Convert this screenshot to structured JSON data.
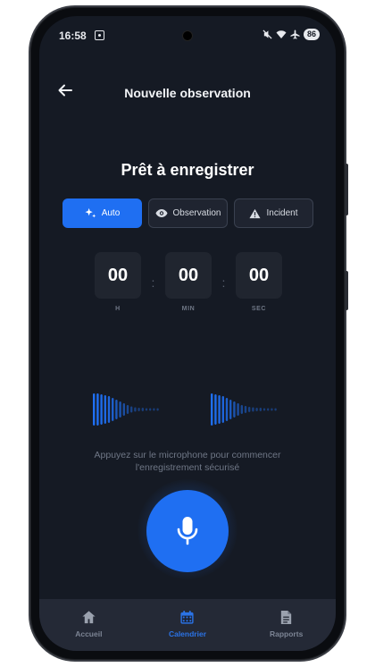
{
  "status": {
    "time": "16:58",
    "battery": "86"
  },
  "header": {
    "title": "Nouvelle observation",
    "back_icon": "arrow-left-icon"
  },
  "main": {
    "title": "Prêt à enregistrer",
    "modes": [
      {
        "label": "Auto",
        "icon": "sparkles-icon",
        "active": true
      },
      {
        "label": "Observation",
        "icon": "eye-icon",
        "active": false
      },
      {
        "label": "Incident",
        "icon": "warning-triangle-icon",
        "active": false
      }
    ],
    "timer": {
      "hours": "00",
      "minutes": "00",
      "seconds": "00",
      "hours_label": "H",
      "minutes_label": "MIN",
      "seconds_label": "SEC"
    },
    "hint": "Appuyez sur le microphone pour commencer l'enregistrement sécurisé"
  },
  "nav": {
    "items": [
      {
        "label": "Accueil",
        "icon": "home-icon",
        "active": false
      },
      {
        "label": "Calendrier",
        "icon": "calendar-icon",
        "active": true
      },
      {
        "label": "Rapports",
        "icon": "document-icon",
        "active": false
      }
    ]
  },
  "colors": {
    "accent": "#1f6ff2",
    "background": "#151a24",
    "nav_bg": "#242936"
  }
}
